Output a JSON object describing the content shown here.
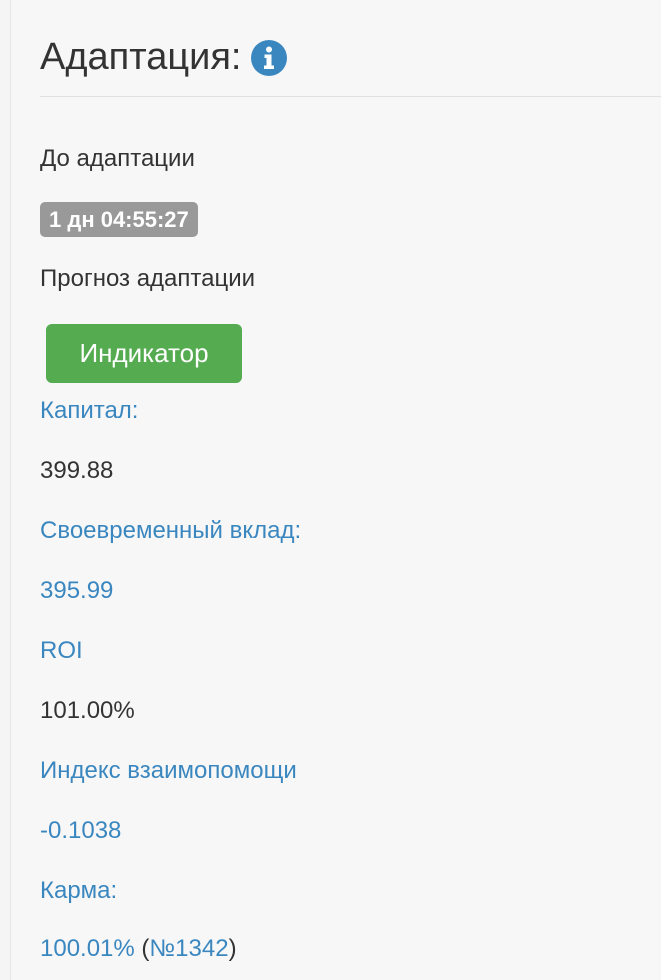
{
  "header": {
    "title": "Адаптация:"
  },
  "adaptation": {
    "until_label": "До адаптации",
    "timer": "1 дн 04:55:27",
    "forecast_label": "Прогноз адаптации",
    "indicator_button": "Индикатор"
  },
  "stats": {
    "capital_label": "Капитал:",
    "capital_value": "399.88",
    "deposit_label": "Своевременный вклад:",
    "deposit_value": "395.99",
    "roi_label": "ROI",
    "roi_value": "101.00%",
    "mutual_aid_label": "Индекс взаимопомощи",
    "mutual_aid_value": "-0.1038",
    "karma_label": "Карма:",
    "karma_value": "100.01%",
    "karma_open": " (",
    "karma_rank": "№1342",
    "karma_close": ")"
  },
  "colors": {
    "accent_blue": "#3a87c0",
    "button_green": "#55ab50",
    "badge_gray": "#999999"
  },
  "icons": {
    "info": "info-circle-icon"
  }
}
